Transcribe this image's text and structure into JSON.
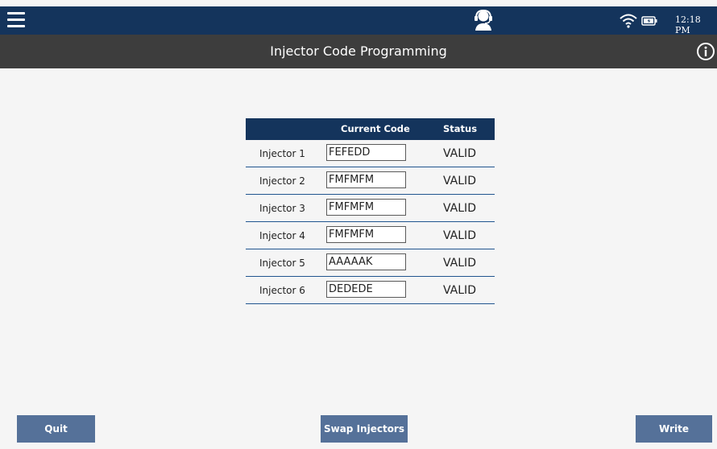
{
  "status_bar": {
    "time": "12:18 PM",
    "icons": {
      "menu": "hamburger-menu-icon",
      "support": "support-agent-icon",
      "wifi": "wifi-icon",
      "battery": "battery-charging-icon"
    }
  },
  "header": {
    "title": "Injector Code Programming",
    "info_icon": "info-icon"
  },
  "table": {
    "columns": [
      "",
      "Current Code",
      "Status"
    ],
    "rows": [
      {
        "label": "Injector 1",
        "code": "FEFEDD",
        "status": "VALID"
      },
      {
        "label": "Injector 2",
        "code": "FMFMFM",
        "status": "VALID"
      },
      {
        "label": "Injector 3",
        "code": "FMFMFM",
        "status": "VALID"
      },
      {
        "label": "Injector 4",
        "code": "FMFMFM",
        "status": "VALID"
      },
      {
        "label": "Injector 5",
        "code": "AAAAAK",
        "status": "VALID"
      },
      {
        "label": "Injector 6",
        "code": "DEDEDE",
        "status": "VALID"
      }
    ]
  },
  "footer": {
    "quit_label": "Quit",
    "swap_label": "Swap Injectors",
    "write_label": "Write"
  },
  "colors": {
    "topbar": "#14345c",
    "titlebar": "#3d3d3d",
    "table_header": "#14345c",
    "button": "#557199",
    "background": "#f5f5f5"
  }
}
